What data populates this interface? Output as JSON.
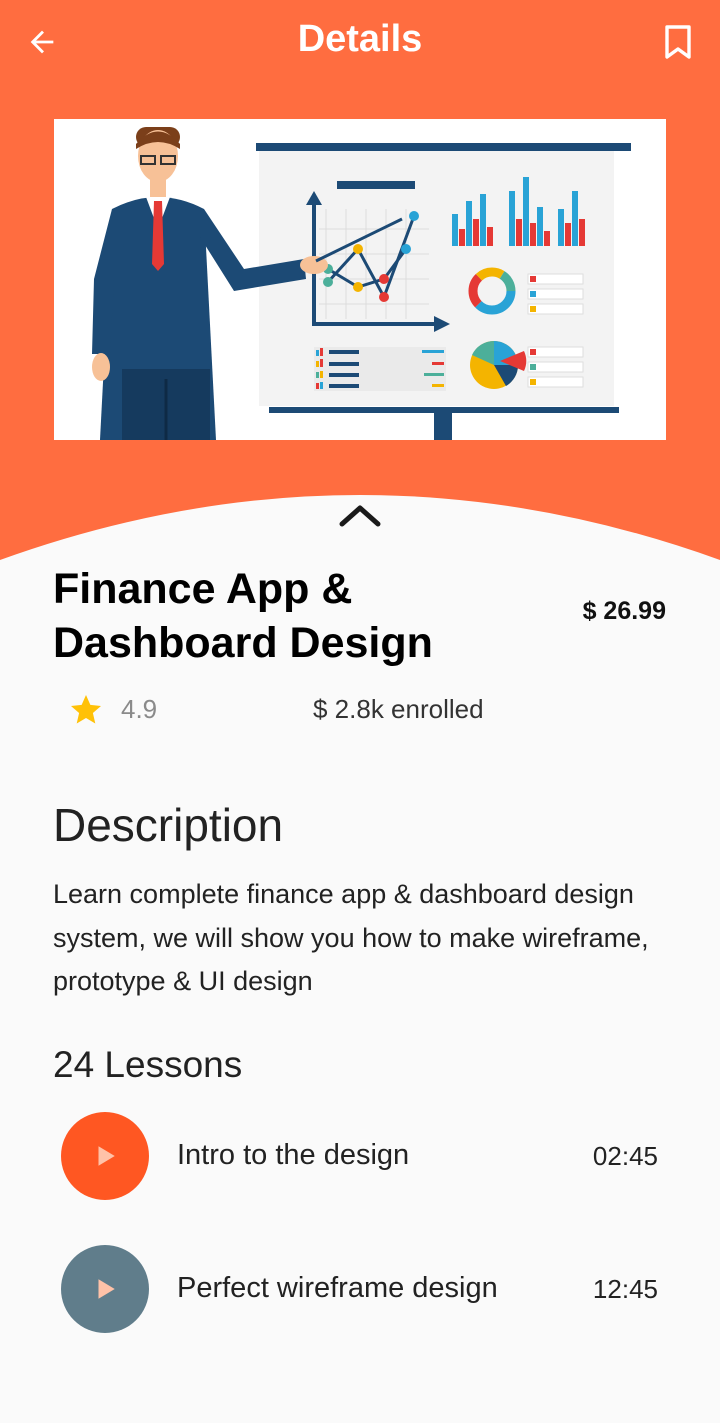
{
  "colors": {
    "accent": "#ff6d40",
    "play_active": "#ff5722",
    "play_inactive": "#607d8b",
    "background": "#fafafa"
  },
  "header": {
    "title": "Details",
    "back_icon": "arrow-left-icon",
    "bookmark_icon": "bookmark-icon"
  },
  "hero": {
    "image": "presenter-illustration",
    "collapse_icon": "chevron-up-icon"
  },
  "course": {
    "title": "Finance App & Dashboard Design",
    "price": "$ 26.99",
    "rating": "4.9",
    "enrolled": "$ 2.8k enrolled"
  },
  "description": {
    "heading": "Description",
    "text": "Learn complete finance app & dashboard design system, we will show you how to make wireframe, prototype & UI design"
  },
  "lessons": {
    "heading": "24 Lessons",
    "items": [
      {
        "title": "Intro to the design",
        "duration": "02:45",
        "active": true
      },
      {
        "title": "Perfect wireframe design",
        "duration": "12:45",
        "active": false
      }
    ]
  }
}
